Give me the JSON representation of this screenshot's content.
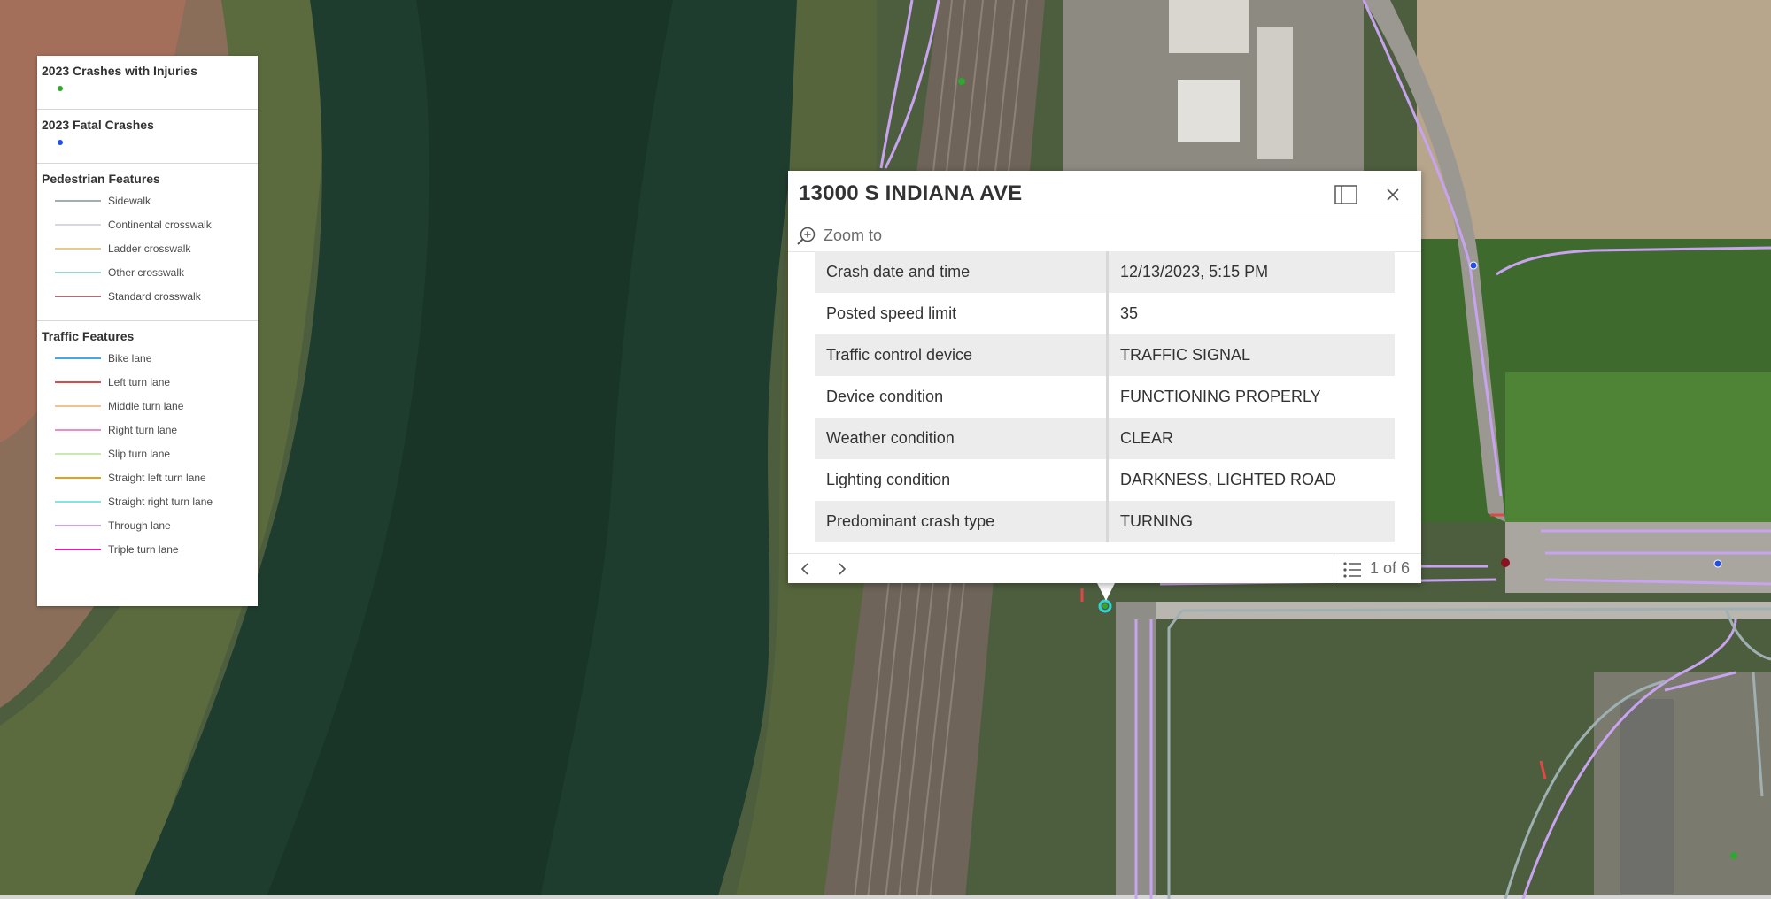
{
  "legend": {
    "sections": [
      {
        "title": "2023 Crashes with Injuries",
        "dot_color": "#2ea82e"
      },
      {
        "title": "2023 Fatal Crashes",
        "dot_color": "#1f4fe8"
      }
    ],
    "pedestrian": {
      "title": "Pedestrian Features",
      "items": [
        {
          "label": "Sidewalk",
          "color": "#9fb0b3"
        },
        {
          "label": "Continental crosswalk",
          "color": "#d9d4e6"
        },
        {
          "label": "Ladder crosswalk",
          "color": "#e7c98c"
        },
        {
          "label": "Other crosswalk",
          "color": "#9fd3c9"
        },
        {
          "label": "Standard crosswalk",
          "color": "#a8707a"
        }
      ]
    },
    "traffic": {
      "title": "Traffic Features",
      "items": [
        {
          "label": "Bike lane",
          "color": "#43a9de"
        },
        {
          "label": "Left turn lane",
          "color": "#e04848"
        },
        {
          "label": "Middle turn lane",
          "color": "#f3c090"
        },
        {
          "label": "Right turn lane",
          "color": "#f08acb"
        },
        {
          "label": "Slip turn lane",
          "color": "#c7eab1"
        },
        {
          "label": "Straight left turn lane",
          "color": "#ee9b1a"
        },
        {
          "label": "Straight right turn lane",
          "color": "#7fe8dc"
        },
        {
          "label": "Through lane",
          "color": "#c8a3ef"
        },
        {
          "label": "Triple turn lane",
          "color": "#e21caa"
        }
      ]
    }
  },
  "popup": {
    "title": "13000 S INDIANA AVE",
    "zoom_label": "Zoom to",
    "rows": [
      {
        "field": "Crash date and time",
        "value": "12/13/2023, 5:15 PM"
      },
      {
        "field": "Posted speed limit",
        "value": "35"
      },
      {
        "field": "Traffic control device",
        "value": "TRAFFIC SIGNAL"
      },
      {
        "field": "Device condition",
        "value": "FUNCTIONING PROPERLY"
      },
      {
        "field": "Weather condition",
        "value": "CLEAR"
      },
      {
        "field": "Lighting condition",
        "value": "DARKNESS, LIGHTED ROAD"
      },
      {
        "field": "Predominant crash type",
        "value": "TURNING"
      }
    ],
    "feature_count": "1 of 6",
    "icons": {
      "dock": "dock-icon",
      "close": "close-icon",
      "zoom": "zoom-in-icon",
      "prev": "chevron-left-icon",
      "next": "chevron-right-icon",
      "list": "list-icon"
    }
  },
  "colors": {
    "selection_highlight": "#2fd3d3",
    "through_lane": "#c8a3ef",
    "sidewalk": "#9fb0b3",
    "fatal_crash": "#1f4fe8",
    "injury_crash": "#2ea82e"
  }
}
